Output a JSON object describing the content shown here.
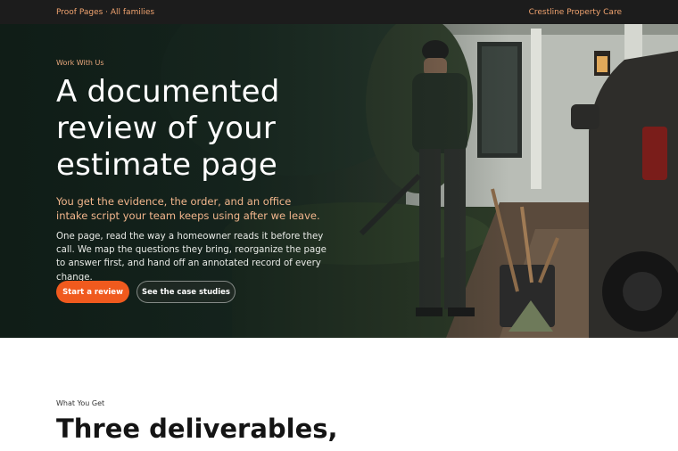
{
  "topbar": {
    "left_link": "Proof Pages · All families",
    "right_link": "Crestline Property Care"
  },
  "hero": {
    "eyebrow": "Work With Us",
    "headline": "A documented review of your estimate page",
    "subhead": "You get the evidence, the order, and an office intake script your team keeps using after we leave.",
    "body": "One page, read the way a homeowner reads it before they call. We map the questions they bring, reorganize the page to answer first, and hand off an annotated record of every change.",
    "primary_button": "Start a review",
    "secondary_button": "See the case studies"
  },
  "section": {
    "eyebrow": "What You Get",
    "title": "Three deliverables,"
  },
  "colors": {
    "accent": "#f05a1e",
    "topbar_bg": "#1c1c1c",
    "topbar_text": "#f0a36f",
    "subhead_text": "#f2b68c"
  }
}
